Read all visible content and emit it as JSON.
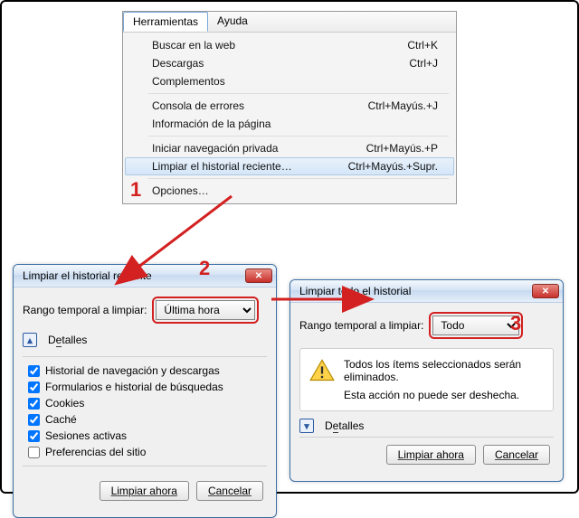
{
  "menubar": {
    "tools": "Herramientas",
    "help": "Ayuda"
  },
  "menu": {
    "items": [
      {
        "label": "Buscar en la web",
        "shortcut": "Ctrl+K"
      },
      {
        "label": "Descargas",
        "shortcut": "Ctrl+J"
      },
      {
        "label": "Complementos",
        "shortcut": ""
      },
      {
        "sep": true
      },
      {
        "label": "Consola de errores",
        "shortcut": "Ctrl+Mayús.+J"
      },
      {
        "label": "Información de la página",
        "shortcut": ""
      },
      {
        "sep": true
      },
      {
        "label": "Iniciar navegación privada",
        "shortcut": "Ctrl+Mayús.+P"
      },
      {
        "label": "Limpiar el historial reciente…",
        "shortcut": "Ctrl+Mayús.+Supr.",
        "highlight": true
      },
      {
        "sep": true
      },
      {
        "label": "Opciones…",
        "shortcut": ""
      }
    ]
  },
  "dlg1": {
    "title": "Limpiar el historial reciente",
    "range_label": "Rango temporal a limpiar:",
    "range_value": "Última hora",
    "details_label": "Detalles",
    "checks": [
      {
        "label": "Historial de navegación y descargas",
        "checked": true
      },
      {
        "label": "Formularios e historial de búsquedas",
        "checked": true
      },
      {
        "label": "Cookies",
        "checked": true
      },
      {
        "label": "Caché",
        "checked": true
      },
      {
        "label": "Sesiones activas",
        "checked": true
      },
      {
        "label": "Preferencias del sitio",
        "checked": false
      }
    ],
    "ok": "Limpiar ahora",
    "cancel": "Cancelar"
  },
  "dlg2": {
    "title": "Limpiar todo el historial",
    "range_label": "Rango temporal a limpiar:",
    "range_value": "Todo",
    "warn_line1": "Todos los ítems seleccionados serán eliminados.",
    "warn_line2": "Esta acción no puede ser deshecha.",
    "details_label": "Detalles",
    "ok": "Limpiar ahora",
    "cancel": "Cancelar"
  },
  "callouts": {
    "one": "1",
    "two": "2",
    "three": "3"
  }
}
